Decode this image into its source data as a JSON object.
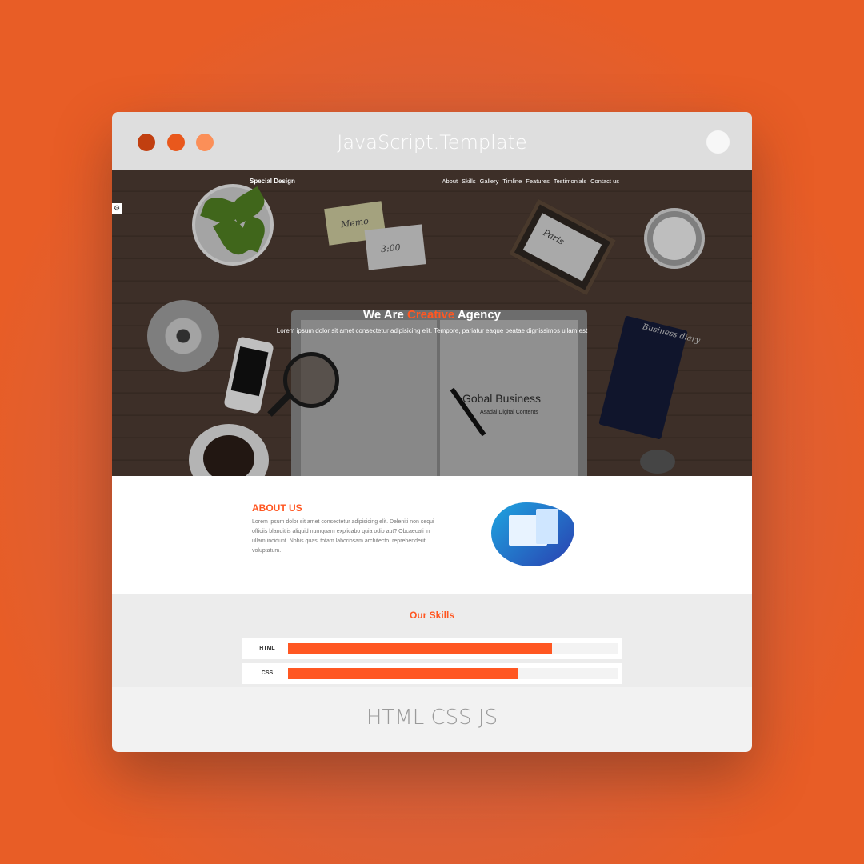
{
  "window": {
    "title": "JavaScript.Template",
    "traffic_light_colors": [
      "#c13f10",
      "#e9581c",
      "#fb8f58"
    ],
    "footer_label": "HTML CSS JS"
  },
  "site": {
    "logo": "Special Design",
    "nav": [
      "About",
      "Skills",
      "Gallery",
      "Timline",
      "Features",
      "Testimonials",
      "Contact us"
    ],
    "settings_icon": "gear-icon",
    "accent_color": "#ff5722"
  },
  "hero": {
    "title_before": "We Are",
    "title_accent": "Creative",
    "title_after": "Agency",
    "subtitle": "Lorem ipsum dolor sit amet consectetur adipisicing elit. Tempore, pariatur eaque beatae dignissimos ullam est",
    "image_text": {
      "memo": "Memo",
      "memo_time": "3:00",
      "frame": "Paris",
      "notebook_title": "Gobal Business",
      "notebook_subtitle": "Asadal Digital Contents",
      "diary": "Business diary"
    }
  },
  "about": {
    "title": "ABOUT US",
    "text": "Lorem ipsum dolor sit amet consectetur adipisicing elit. Deleniti non sequi officiis blanditiis aliquid numquam explicabo quia odio aut? Obcaecati in ullam incidunt. Nobis quasi totam laboriosam architecto, reprehenderit voluptatum."
  },
  "skills": {
    "title": "Our Skills",
    "items": [
      {
        "label": "HTML",
        "progress": 0.8
      },
      {
        "label": "CSS",
        "progress": 0.7
      }
    ]
  }
}
